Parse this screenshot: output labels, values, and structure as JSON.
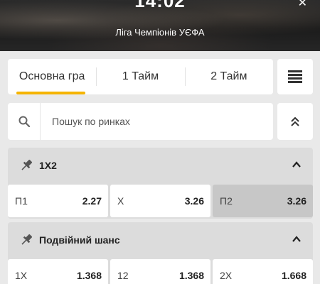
{
  "header": {
    "time": "14:02",
    "league": "Ліга Чемпіонів УЄФА"
  },
  "tabs": [
    {
      "label": "Основна гра",
      "active": true
    },
    {
      "label": "1 Тайм",
      "active": false
    },
    {
      "label": "2 Тайм",
      "active": false
    }
  ],
  "search": {
    "placeholder": "Пошук по ринках"
  },
  "markets": [
    {
      "title": "1X2",
      "odds": [
        {
          "label": "П1",
          "value": "2.27",
          "selected": false
        },
        {
          "label": "X",
          "value": "3.26",
          "selected": false
        },
        {
          "label": "П2",
          "value": "3.26",
          "selected": true
        }
      ]
    },
    {
      "title": "Подвійний шанс",
      "odds": [
        {
          "label": "1X",
          "value": "1.368",
          "selected": false
        },
        {
          "label": "12",
          "value": "1.368",
          "selected": false
        },
        {
          "label": "2X",
          "value": "1.668",
          "selected": false
        }
      ]
    }
  ],
  "colors": {
    "accent": "#f5b400",
    "selected_odd": "#c7c7c7",
    "market_bg": "#dcdcdc"
  },
  "icons": {
    "menu": "menu-lines-icon",
    "search": "search-icon",
    "collapse": "double-chevron-up-icon",
    "pin": "pin-icon",
    "toggle": "chevron-up-icon"
  }
}
